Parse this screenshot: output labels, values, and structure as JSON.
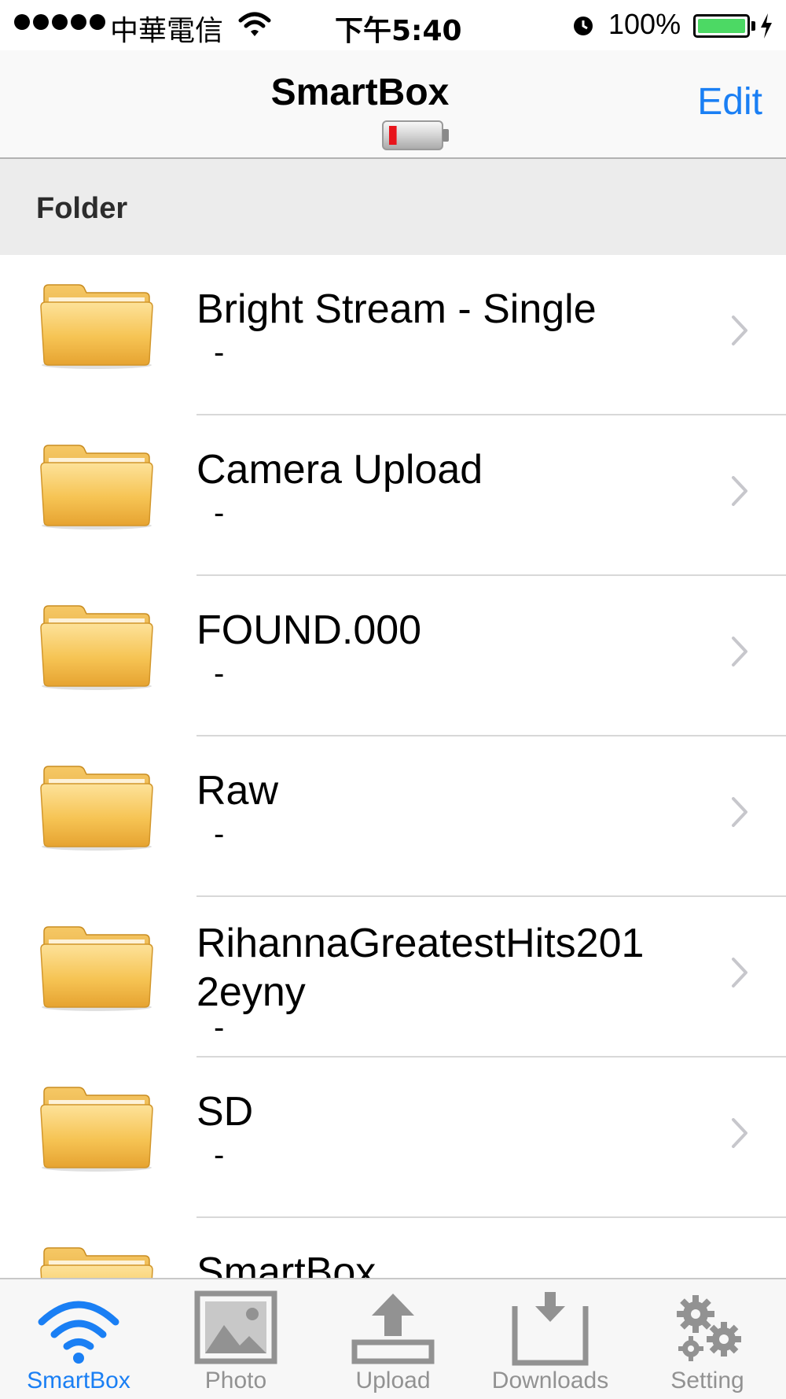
{
  "status_bar": {
    "carrier": "中華電信",
    "time": "下午5:40",
    "battery_percent": "100%",
    "battery_level": 1.0
  },
  "nav": {
    "title": "SmartBox",
    "edit_label": "Edit",
    "device_battery_level": 0.15
  },
  "section": {
    "title": "Folder"
  },
  "folders": [
    {
      "name": "Bright Stream - Single",
      "sub": "-"
    },
    {
      "name": "Camera Upload",
      "sub": "-"
    },
    {
      "name": "FOUND.000",
      "sub": "-"
    },
    {
      "name": "Raw",
      "sub": "-"
    },
    {
      "name": "RihannaGreatestHits201 2eyny",
      "sub": "-"
    },
    {
      "name": "SD",
      "sub": "-"
    },
    {
      "name": "SmartBox",
      "sub": ""
    }
  ],
  "tabs": [
    {
      "label": "SmartBox",
      "icon": "wifi-icon",
      "active": true
    },
    {
      "label": "Photo",
      "icon": "photo-icon",
      "active": false
    },
    {
      "label": "Upload",
      "icon": "upload-icon",
      "active": false
    },
    {
      "label": "Downloads",
      "icon": "downloads-icon",
      "active": false
    },
    {
      "label": "Setting",
      "icon": "gears-icon",
      "active": false
    }
  ],
  "colors": {
    "accent": "#1a7ff4",
    "tab_inactive": "#929292",
    "battery_green": "#4cd964",
    "folder_yellow": "#f2b844"
  }
}
